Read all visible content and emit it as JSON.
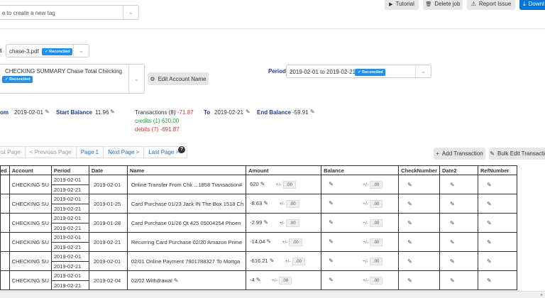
{
  "tag_input": {
    "placeholder": "e to create a new tag"
  },
  "toolbar": {
    "tutorial": "Tutorial",
    "delete_job": "Delete job",
    "report_issue": "Report Issue",
    "download": "Downl"
  },
  "file": {
    "label": "t",
    "value": "chase-3.pdf",
    "badge": "Reconciled"
  },
  "account": {
    "value": "CHECKING SUMMARY Chase Total Checking",
    "badge": "Reconciled",
    "edit_button": "Edit Account Name"
  },
  "period": {
    "label": "Period",
    "value": "2019-02-01 to 2019-02-21",
    "badge": "Reconciled"
  },
  "summary": {
    "from_label": "om",
    "from_date": "2019-02-01",
    "start_balance_label": "Start Balance",
    "start_balance": "11.96",
    "transactions": "Transactions (8)",
    "transactions_amount": "-71.87",
    "credits": "credits (1) 620.00",
    "debits": "debits (7) -691.87",
    "to_label": "To",
    "to_date": "2019-02-21",
    "end_balance_label": "End Balance",
    "end_balance": "-59.91"
  },
  "pager": {
    "first": "rst Page",
    "prev": "< Previous Page",
    "page": "Page 1",
    "next": "Next Page >",
    "last": "Last Page >>"
  },
  "actions": {
    "add": "Add Transaction",
    "bulk": "Bulk Edit Transactio"
  },
  "table": {
    "headers": [
      "ed",
      "Account",
      "Period",
      "Date",
      "Name",
      "Amount",
      "Balance",
      "CheckNumber",
      "Date2",
      "RefNumber"
    ],
    "plus_minus": "+/-",
    "zero": ".00",
    "rows": [
      {
        "account": "CHECKING SU",
        "period_start": "2019-02-01",
        "period_end": "2019-02-21",
        "date": "2019-02-01",
        "name": "Online Transfer From Chk ...1858 Transaction#",
        "amount": "620"
      },
      {
        "account": "CHECKING SU",
        "period_start": "2019-02-01",
        "period_end": "2019-02-21",
        "date": "2019-01-25",
        "name": "Card Purchase 01/23 Jack IN The Box 1518 Ch",
        "amount": "-8.63"
      },
      {
        "account": "CHECKING SU",
        "period_start": "2019-02-01",
        "period_end": "2019-02-21",
        "date": "2019-01-28",
        "name": "Card Purchase 01/26 Qt 425 05004254 Phoen",
        "amount": "-2.99"
      },
      {
        "account": "CHECKING SU",
        "period_start": "2019-02-01",
        "period_end": "2019-02-21",
        "date": "2019-02-21",
        "name": "Recurring Card Purchase 02/20 Amazon Prime",
        "amount": "-14.04"
      },
      {
        "account": "CHECKING SU",
        "period_start": "2019-02-01",
        "period_end": "2019-02-21",
        "date": "2019-02-01",
        "name": "02/01 Online Payment 7901788327 To Mortga",
        "amount": "-616.21"
      },
      {
        "account": "CHECKING SU",
        "period_start": "2019-02-01",
        "period_end": "2019-02-21",
        "date": "2019-02-04",
        "name": "02/02 Withdrawal",
        "amount": "-4"
      }
    ]
  }
}
